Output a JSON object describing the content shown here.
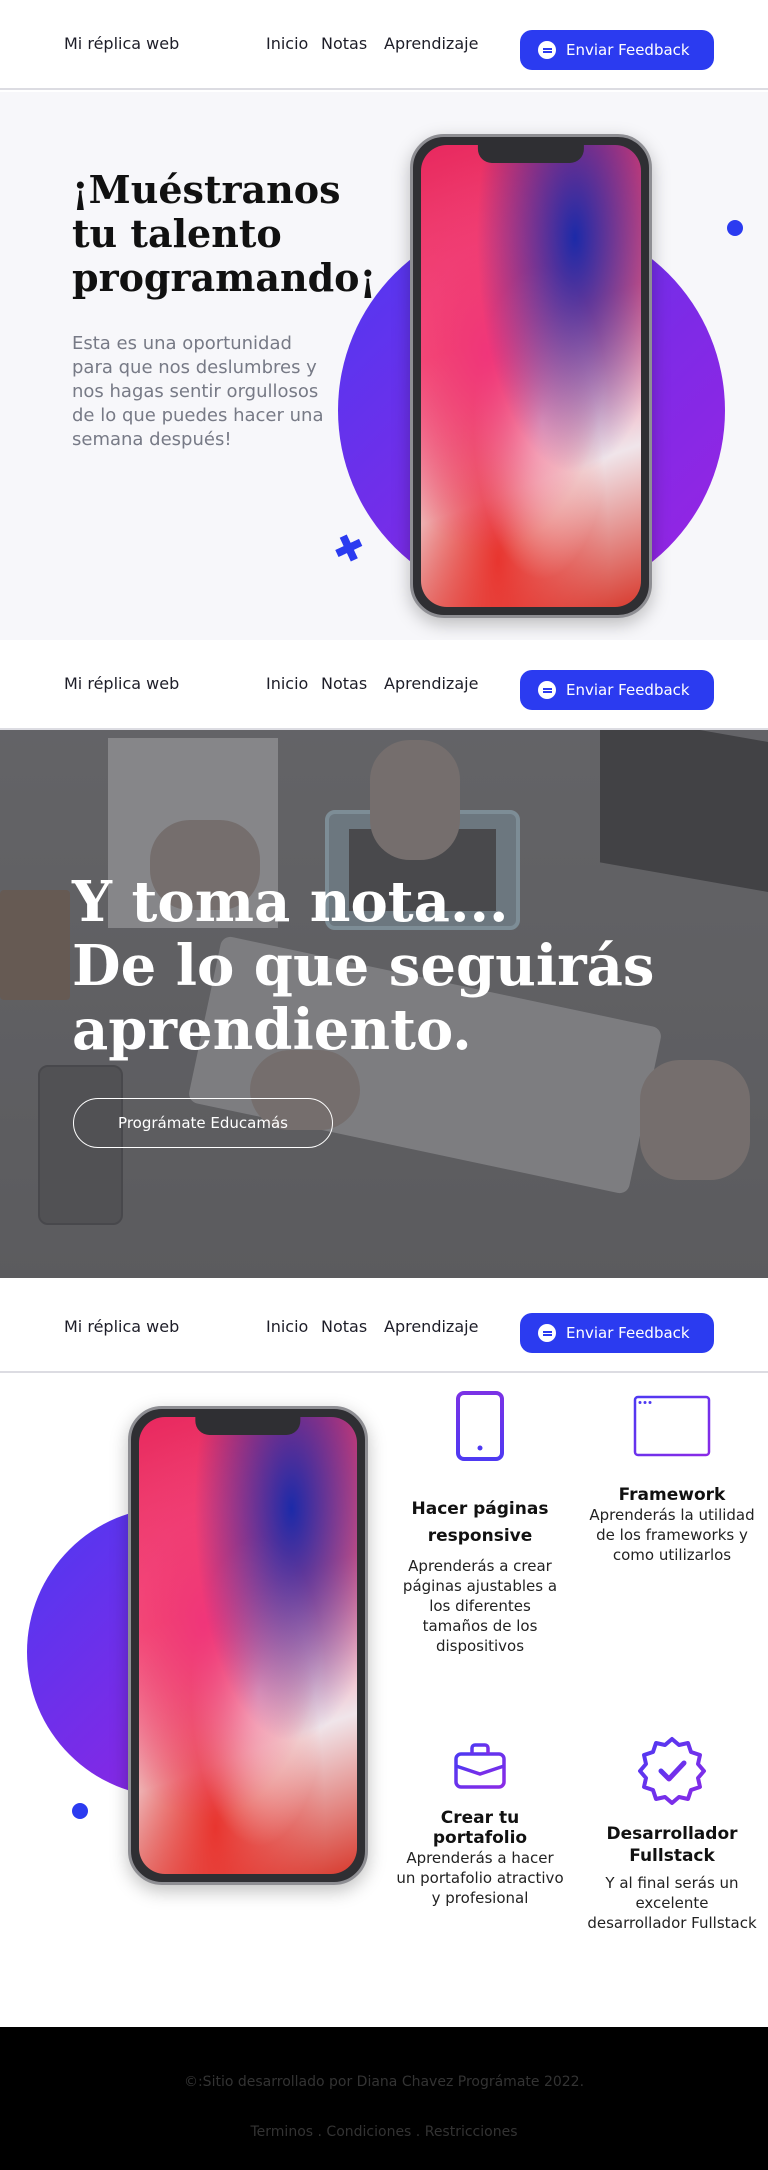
{
  "nav": {
    "brand": "Mi réplica web",
    "links": [
      "Inicio",
      "Notas",
      "Aprendizaje"
    ],
    "feedback_label": "Enviar Feedback"
  },
  "hero": {
    "title": "¡Muéstranos tu talento programando¡",
    "description": "Esta es una oportunidad para que nos deslumbres y nos hagas sentir orgullosos de lo que puedes hacer una semana después!"
  },
  "notes": {
    "title_line1": "Y toma nota...",
    "title_line2": "De lo que seguirás aprendiento.",
    "button_label": "Prográmate Educamás"
  },
  "features": [
    {
      "title": "Hacer páginas responsive",
      "text": "Aprenderás a crear páginas ajustables a los diferentes tamaños de los dispositivos",
      "icon": "smartphone-icon"
    },
    {
      "title": "Framework",
      "text": "Aprenderás la utilidad de los frameworks y como utilizarlos",
      "icon": "browser-window-icon"
    },
    {
      "title": "Crear tu portafolio",
      "text": "Aprenderás a hacer un portafolio atractivo y profesional",
      "icon": "briefcase-icon"
    },
    {
      "title": "Desarrollador Fullstack",
      "text": "Y al final serás un excelente desarrollador Fullstack",
      "icon": "verified-badge-icon"
    }
  ],
  "footer": {
    "credit": "©:Sitio desarrollado por Diana Chavez Prográmate 2022.",
    "links": [
      "Terminos",
      "Condiciones",
      "Restricciones"
    ],
    "separator": " . "
  },
  "colors": {
    "accent": "#2b3bf0",
    "purple": "#7f2ae6",
    "hero_bg": "#f7f7fa",
    "footer_bg": "#000000"
  }
}
